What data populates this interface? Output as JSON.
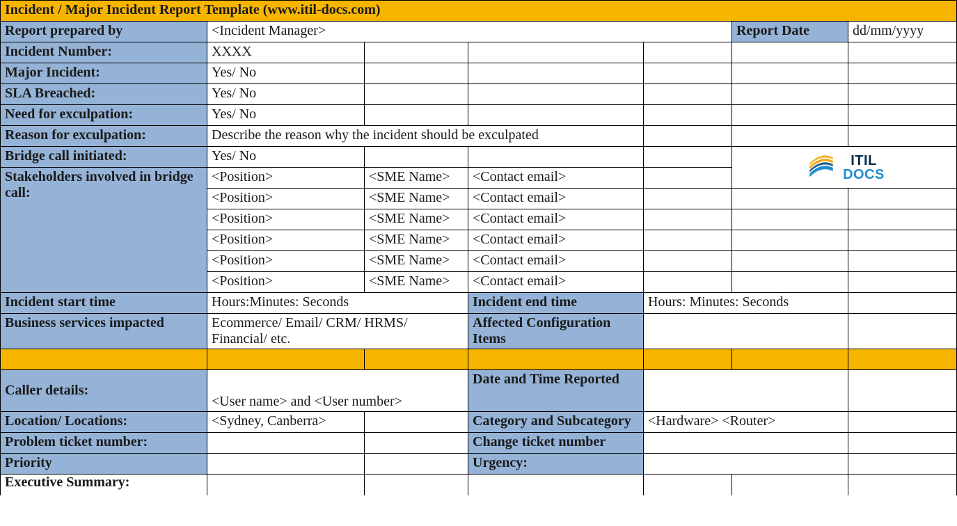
{
  "title": "Incident / Major Incident Report Template   (www.itil-docs.com)",
  "rows": {
    "report_prepared_by_lbl": "Report prepared by",
    "report_prepared_by_val": "<Incident Manager>",
    "report_date_lbl": "Report Date",
    "report_date_val": "dd/mm/yyyy",
    "incident_number_lbl": "Incident Number:",
    "incident_number_val": "XXXX",
    "major_incident_lbl": "Major Incident:",
    "major_incident_val": "Yes/ No",
    "sla_breached_lbl": "SLA Breached:",
    "sla_breached_val": "Yes/ No",
    "need_exculpation_lbl": "Need for exculpation:",
    "need_exculpation_val": "Yes/ No",
    "reason_exculpation_lbl": "Reason for exculpation:",
    "reason_exculpation_val": "Describe the reason why the incident should be exculpated",
    "bridge_call_lbl": "Bridge call initiated:",
    "bridge_call_val": "Yes/ No",
    "stakeholders_lbl": "Stakeholders involved in bridge call:",
    "stakeholders": [
      {
        "position": "<Position>",
        "sme": "<SME Name>",
        "email": "<Contact email>"
      },
      {
        "position": "<Position>",
        "sme": "<SME Name>",
        "email": "<Contact email>"
      },
      {
        "position": "<Position>",
        "sme": "<SME Name>",
        "email": "<Contact email>"
      },
      {
        "position": "<Position>",
        "sme": "<SME Name>",
        "email": "<Contact email>"
      },
      {
        "position": "<Position>",
        "sme": "<SME Name>",
        "email": "<Contact email>"
      },
      {
        "position": "<Position>",
        "sme": "<SME Name>",
        "email": "<Contact email>"
      }
    ],
    "incident_start_lbl": "Incident start time",
    "incident_start_val": "Hours:Minutes: Seconds",
    "incident_end_lbl": "Incident end time",
    "incident_end_val": "Hours: Minutes: Seconds",
    "biz_services_lbl": "Business services impacted",
    "biz_services_val": "Ecommerce/ Email/ CRM/ HRMS/ Financial/ etc.",
    "affected_ci_lbl": "Affected Configuration Items",
    "caller_details_lbl": "Caller details:",
    "caller_details_val": "<User name> and <User number>",
    "date_time_reported_lbl": "Date and Time Reported",
    "location_lbl": "Location/ Locations:",
    "location_val": "<Sydney, Canberra>",
    "category_lbl": "Category and Subcategory",
    "category_val": "<Hardware> <Router>",
    "problem_ticket_lbl": "Problem ticket number:",
    "change_ticket_lbl": "Change ticket number",
    "priority_lbl": "Priority",
    "urgency_lbl": "Urgency:",
    "exec_summary_lbl": "Executive Summary:"
  },
  "logo": {
    "top": "ITIL",
    "bottom": "DOCS"
  }
}
